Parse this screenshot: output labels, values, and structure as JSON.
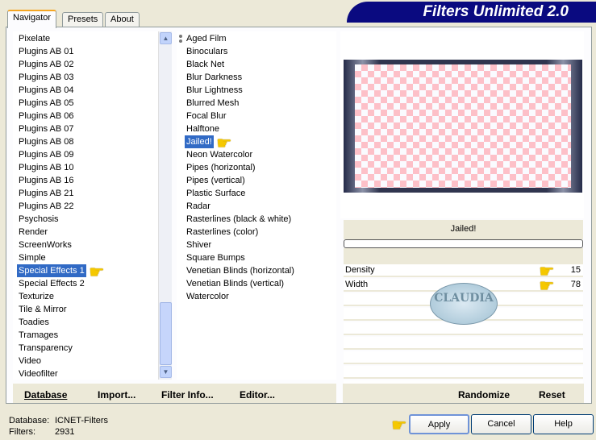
{
  "title": "Filters Unlimited 2.0",
  "tabs": [
    "Navigator",
    "Presets",
    "About"
  ],
  "categories": [
    "Pixelate",
    "Plugins AB 01",
    "Plugins AB 02",
    "Plugins AB 03",
    "Plugins AB 04",
    "Plugins AB 05",
    "Plugins AB 06",
    "Plugins AB 07",
    "Plugins AB 08",
    "Plugins AB 09",
    "Plugins AB 10",
    "Plugins AB 16",
    "Plugins AB 21",
    "Plugins AB 22",
    "Psychosis",
    "Render",
    "ScreenWorks",
    "Simple",
    "Special Effects 1",
    "Special Effects 2",
    "Texturize",
    "Tile & Mirror",
    "Toadies",
    "Tramages",
    "Transparency",
    "Video",
    "Videofilter"
  ],
  "selected_category": "Special Effects 1",
  "filters": [
    "Aged Film",
    "Binoculars",
    "Black Net",
    "Blur Darkness",
    "Blur Lightness",
    "Blurred Mesh",
    "Focal Blur",
    "Halftone",
    "Jailed!",
    "Neon Watercolor",
    "Pipes (horizontal)",
    "Pipes (vertical)",
    "Plastic Surface",
    "Radar",
    "Rasterlines (black & white)",
    "Rasterlines (color)",
    "Shiver",
    "Square Bumps",
    "Venetian Blinds (horizontal)",
    "Venetian Blinds (vertical)",
    "Watercolor"
  ],
  "selected_filter": "Jailed!",
  "filter_name": "Jailed!",
  "progress": 0,
  "params": [
    {
      "label": "Density",
      "value": "15"
    },
    {
      "label": "Width",
      "value": "78"
    }
  ],
  "watermark": "CLAUDIA",
  "left_buttons": [
    "Database",
    "Import...",
    "Filter Info...",
    "Editor..."
  ],
  "right_buttons": [
    "Randomize",
    "Reset"
  ],
  "footer": {
    "database_label": "Database:",
    "database_value": "ICNET-Filters",
    "filters_label": "Filters:",
    "filters_value": "2931"
  },
  "dialog_buttons": {
    "apply": "Apply",
    "cancel": "Cancel",
    "help": "Help"
  },
  "colors": {
    "banner": "#0a0a80",
    "selection": "#316ac5",
    "pointer": "#f5c800"
  }
}
